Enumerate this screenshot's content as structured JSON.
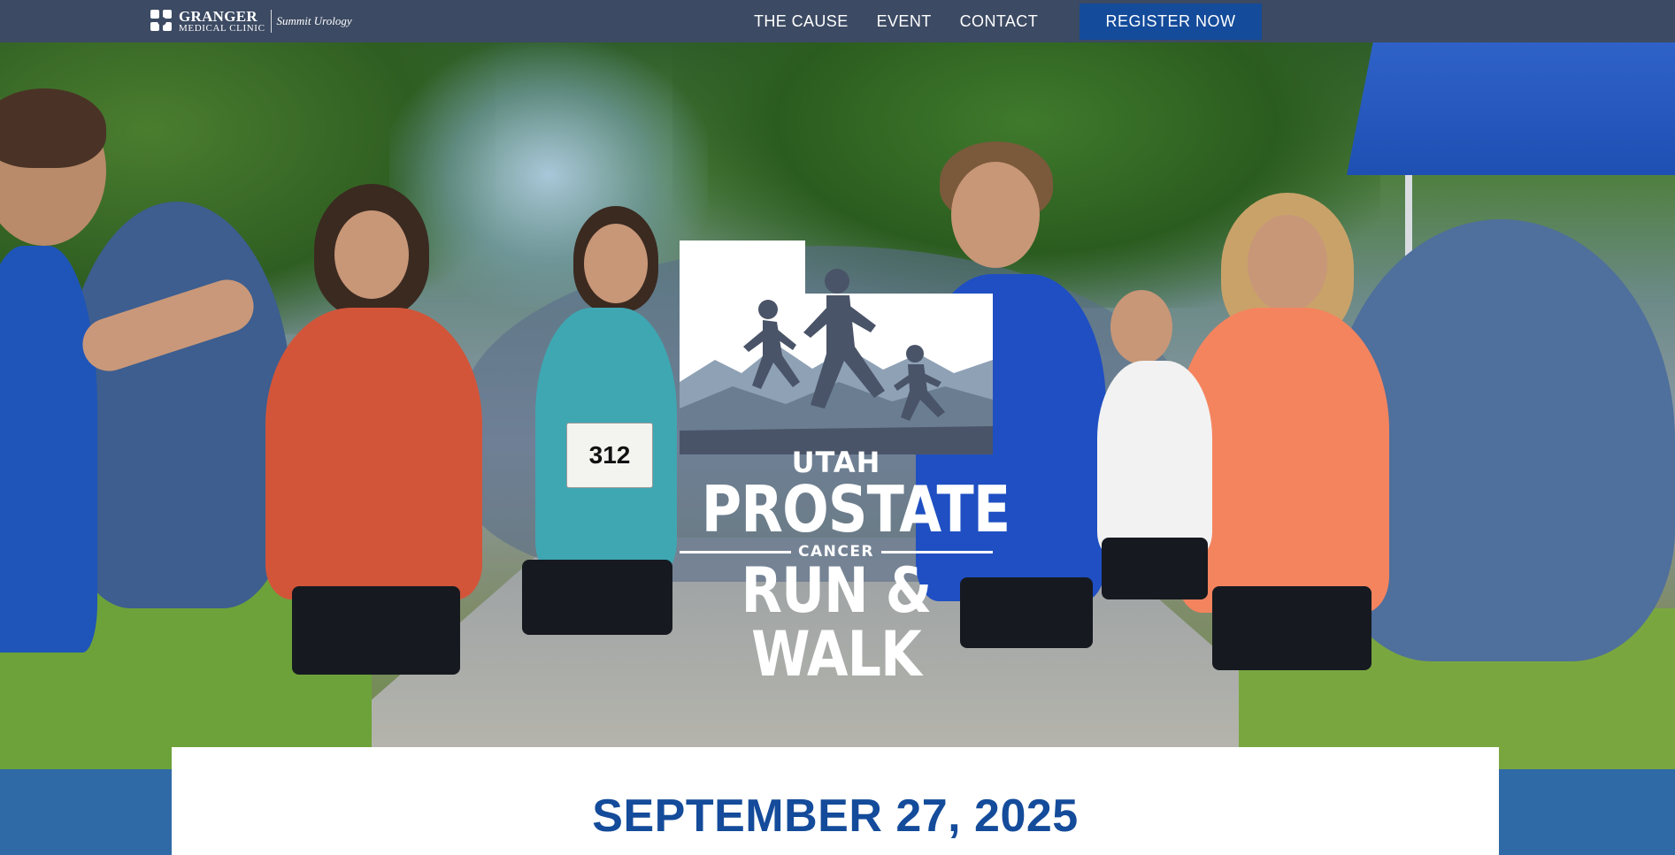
{
  "header": {
    "logo": {
      "icon": "granger-clinic-mark-icon",
      "name": "GRANGER",
      "subtitle": "MEDICAL CLINIC",
      "partner": "Summit Urology"
    },
    "nav": [
      {
        "label": "THE CAUSE"
      },
      {
        "label": "EVENT"
      },
      {
        "label": "CONTACT"
      }
    ],
    "cta_label": "REGISTER NOW"
  },
  "hero": {
    "image": "runners-race-photo",
    "runner_bib": "312",
    "event_logo": {
      "line1": "UTAH",
      "line2": "PROSTATE",
      "line3": "CANCER",
      "line4": "RUN & WALK"
    }
  },
  "event": {
    "date": "SEPTEMBER 27, 2025"
  },
  "colors": {
    "header_bg": "#3c4a63",
    "accent_blue": "#144b9a",
    "band_blue": "#2f6aa6",
    "logo_slate": "#4a5468"
  }
}
